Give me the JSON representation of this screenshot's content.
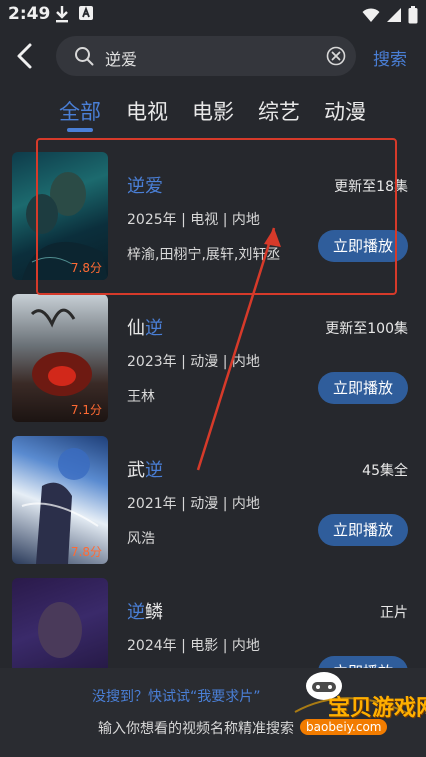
{
  "status_bar": {
    "time": "2:49"
  },
  "search": {
    "value": "逆爱",
    "submit_label": "搜索"
  },
  "tabs": [
    {
      "label": "全部"
    },
    {
      "label": "电视"
    },
    {
      "label": "电影"
    },
    {
      "label": "综艺"
    },
    {
      "label": "动漫"
    }
  ],
  "results": [
    {
      "title_plain": "",
      "title_highlight": "逆爱",
      "title_after": "",
      "meta": "2025年 | 电视 | 内地",
      "cast": "梓渝,田栩宁,展轩,刘轩丞",
      "status": "更新至18集",
      "rating": "7.8分",
      "play_label": "立即播放"
    },
    {
      "title_plain": "仙",
      "title_highlight": "逆",
      "title_after": "",
      "meta": "2023年 | 动漫 | 内地",
      "cast": "王林",
      "status": "更新至100集",
      "rating": "7.1分",
      "play_label": "立即播放"
    },
    {
      "title_plain": "武",
      "title_highlight": "逆",
      "title_after": "",
      "meta": "2021年 | 动漫 | 内地",
      "cast": "风浩",
      "status": "45集全",
      "rating": "7.8分",
      "play_label": "立即播放"
    },
    {
      "title_plain": "",
      "title_highlight": "逆",
      "title_after": "鳞",
      "meta": "2024年 | 电影 | 内地",
      "cast": "",
      "status": "正片",
      "rating": "",
      "play_label": "立即播放"
    }
  ],
  "bottom_hint": {
    "line1": "没搜到？快试试“我要求片”",
    "line2": "输入你想看的视频名称精准搜索"
  },
  "watermark": {
    "text": "宝贝游戏网",
    "url": "baobeiy.com"
  },
  "colors": {
    "accent": "#4a7fd6",
    "background": "#26282d",
    "play_button": "#2f5d9b",
    "rating": "#ff6a33",
    "annotation": "#d63a2a"
  }
}
